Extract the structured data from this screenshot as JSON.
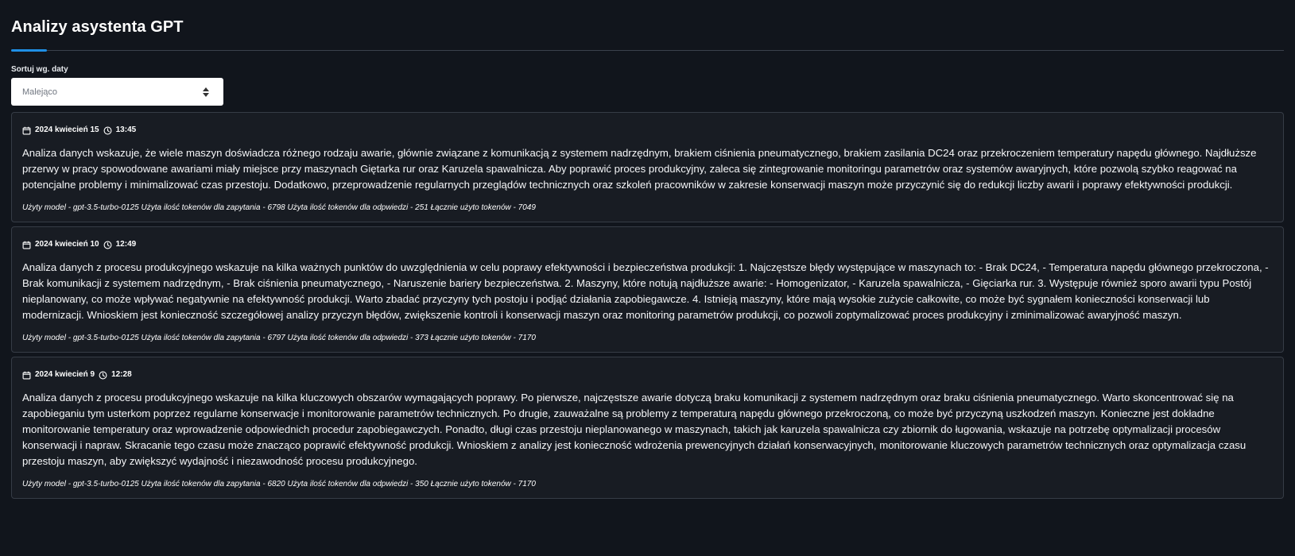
{
  "header": {
    "title": "Analizy asystenta GPT"
  },
  "sort": {
    "label": "Sortuj wg. daty",
    "selected": "Malejąco",
    "icon": "select-arrows-icon"
  },
  "colors": {
    "background": "#11151c",
    "card_background": "#181c23",
    "card_border": "#363c46",
    "accent": "#1f8fe5"
  },
  "icons": {
    "date": "calendar-icon",
    "time": "clock-icon"
  },
  "analyses": [
    {
      "date": "2024 kwiecień 15",
      "time": "13:45",
      "text": "Analiza danych wskazuje, że wiele maszyn doświadcza różnego rodzaju awarie, głównie związane z komunikacją z systemem nadrzędnym, brakiem ciśnienia pneumatycznego, brakiem zasilania DC24 oraz przekroczeniem temperatury napędu głównego. Najdłuższe przerwy w pracy spowodowane awariami miały miejsce przy maszynach Giętarka rur oraz Karuzela spawalnicza. Aby poprawić proces produkcyjny, zaleca się zintegrowanie monitoringu parametrów oraz systemów awaryjnych, które pozwolą szybko reagować na potencjalne problemy i minimalizować czas przestoju. Dodatkowo, przeprowadzenie regularnych przeglądów technicznych oraz szkoleń pracowników w zakresie konserwacji maszyn może przyczynić się do redukcji liczby awarii i poprawy efektywności produkcji.",
      "tokens": "Użyty model - gpt-3.5-turbo-0125 Użyta ilość tokenów dla zapytania - 6798 Użyta ilość tokenów dla odpwiedzi - 251 Łącznie użyto tokenów - 7049"
    },
    {
      "date": "2024 kwiecień 10",
      "time": "12:49",
      "text": "Analiza danych z procesu produkcyjnego wskazuje na kilka ważnych punktów do uwzględnienia w celu poprawy efektywności i bezpieczeństwa produkcji: 1. Najczęstsze błędy występujące w maszynach to: - Brak DC24, - Temperatura napędu głównego przekroczona, - Brak komunikacji z systemem nadrzędnym, - Brak ciśnienia pneumatycznego, - Naruszenie bariery bezpieczeństwa. 2. Maszyny, które notują najdłuższe awarie: - Homogenizator, - Karuzela spawalnicza, - Gięciarka rur. 3. Występuje również sporo awarii typu Postój nieplanowany, co może wpływać negatywnie na efektywność produkcji. Warto zbadać przyczyny tych postoju i podjąć działania zapobiegawcze. 4. Istnieją maszyny, które mają wysokie zużycie całkowite, co może być sygnałem konieczności konserwacji lub modernizacji. Wnioskiem jest konieczność szczegółowej analizy przyczyn błędów, zwiększenie kontroli i konserwacji maszyn oraz monitoring parametrów produkcji, co pozwoli zoptymalizować proces produkcyjny i zminimalizować awaryjność maszyn.",
      "tokens": "Użyty model - gpt-3.5-turbo-0125 Użyta ilość tokenów dla zapytania - 6797 Użyta ilość tokenów dla odpwiedzi - 373 Łącznie użyto tokenów - 7170"
    },
    {
      "date": "2024 kwiecień 9",
      "time": "12:28",
      "text": "Analiza danych z procesu produkcyjnego wskazuje na kilka kluczowych obszarów wymagających poprawy. Po pierwsze, najczęstsze awarie dotyczą braku komunikacji z systemem nadrzędnym oraz braku ciśnienia pneumatycznego. Warto skoncentrować się na zapobieganiu tym usterkom poprzez regularne konserwacje i monitorowanie parametrów technicznych. Po drugie, zauważalne są problemy z temperaturą napędu głównego przekroczoną, co może być przyczyną uszkodzeń maszyn. Konieczne jest dokładne monitorowanie temperatury oraz wprowadzenie odpowiednich procedur zapobiegawczych. Ponadto, długi czas przestoju nieplanowanego w maszynach, takich jak karuzela spawalnicza czy zbiornik do ługowania, wskazuje na potrzebę optymalizacji procesów konserwacji i napraw. Skracanie tego czasu może znacząco poprawić efektywność produkcji. Wnioskiem z analizy jest konieczność wdrożenia prewencyjnych działań konserwacyjnych, monitorowanie kluczowych parametrów technicznych oraz optymalizacja czasu przestoju maszyn, aby zwiększyć wydajność i niezawodność procesu produkcyjnego.",
      "tokens": "Użyty model - gpt-3.5-turbo-0125 Użyta ilość tokenów dla zapytania - 6820 Użyta ilość tokenów dla odpwiedzi - 350 Łącznie użyto tokenów - 7170"
    }
  ]
}
